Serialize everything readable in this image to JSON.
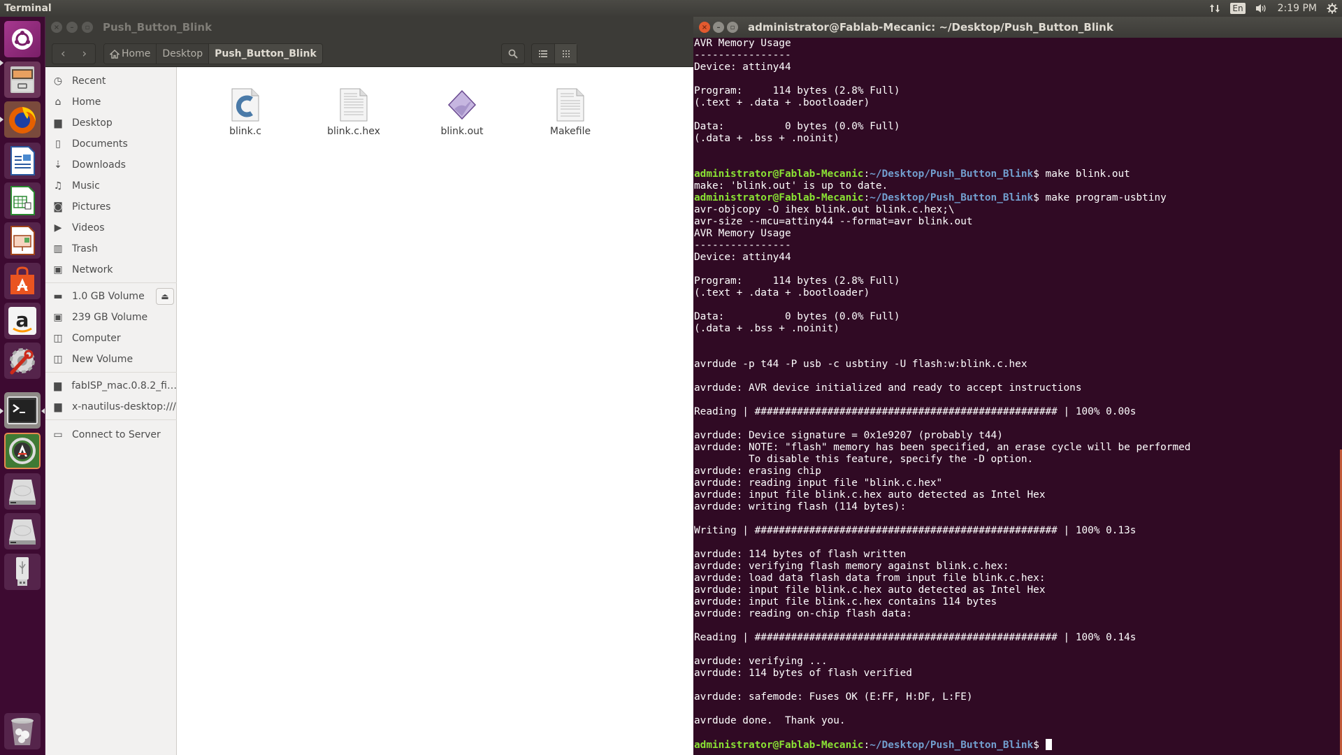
{
  "top_panel": {
    "app_title": "Terminal",
    "indicators": {
      "network": "network-icon",
      "keyboard_layout": "En",
      "sound": "sound-icon",
      "clock": "2:19 PM",
      "system": "gear-icon"
    }
  },
  "launcher": {
    "items": [
      {
        "name": "dash-home",
        "icon": "ubuntu-logo-icon"
      },
      {
        "name": "files",
        "icon": "file-cabinet-icon",
        "running": true
      },
      {
        "name": "firefox",
        "icon": "firefox-icon",
        "running": true
      },
      {
        "name": "libreoffice-writer",
        "icon": "writer-document-icon"
      },
      {
        "name": "libreoffice-calc",
        "icon": "calc-spreadsheet-icon"
      },
      {
        "name": "libreoffice-impress",
        "icon": "impress-presentation-icon"
      },
      {
        "name": "ubuntu-software",
        "icon": "software-bag-icon"
      },
      {
        "name": "amazon",
        "icon": "amazon-icon"
      },
      {
        "name": "system-settings",
        "icon": "settings-wrench-icon"
      },
      {
        "name": "terminal",
        "icon": "terminal-icon",
        "running": true,
        "focused": true
      },
      {
        "name": "software-updater",
        "icon": "updater-icon"
      },
      {
        "name": "drive-1",
        "icon": "hard-drive-icon"
      },
      {
        "name": "drive-2",
        "icon": "hard-drive-icon"
      },
      {
        "name": "usb-drive",
        "icon": "usb-drive-icon"
      },
      {
        "name": "trash",
        "icon": "trash-icon"
      }
    ]
  },
  "nautilus": {
    "title": "Push_Button_Blink",
    "breadcrumbs": [
      "Home",
      "Desktop",
      "Push_Button_Blink"
    ],
    "sidebar": {
      "places": [
        {
          "label": "Recent",
          "icon": "clock-icon"
        },
        {
          "label": "Home",
          "icon": "home-icon"
        },
        {
          "label": "Desktop",
          "icon": "folder-icon"
        },
        {
          "label": "Documents",
          "icon": "document-icon"
        },
        {
          "label": "Downloads",
          "icon": "download-icon"
        },
        {
          "label": "Music",
          "icon": "music-icon"
        },
        {
          "label": "Pictures",
          "icon": "camera-icon"
        },
        {
          "label": "Videos",
          "icon": "video-icon"
        },
        {
          "label": "Trash",
          "icon": "trash-icon"
        },
        {
          "label": "Network",
          "icon": "network-icon"
        }
      ],
      "devices": [
        {
          "label": "1.0 GB Volume",
          "icon": "drive-icon",
          "eject": true
        },
        {
          "label": "239 GB Volume",
          "icon": "chip-drive-icon"
        },
        {
          "label": "Computer",
          "icon": "hard-disk-icon"
        },
        {
          "label": "New Volume",
          "icon": "hard-disk-icon"
        }
      ],
      "bookmarks": [
        {
          "label": "fabISP_mac.0.8.2_fi…",
          "icon": "folder-icon"
        },
        {
          "label": "x-nautilus-desktop:///",
          "icon": "desktop-folder-icon"
        }
      ],
      "other": [
        {
          "label": "Connect to Server",
          "icon": "server-icon"
        }
      ]
    },
    "files": [
      {
        "name": "blink.c",
        "icon": "c-source-file-icon"
      },
      {
        "name": "blink.c.hex",
        "icon": "text-file-icon"
      },
      {
        "name": "blink.out",
        "icon": "executable-file-icon"
      },
      {
        "name": "Makefile",
        "icon": "text-file-icon"
      }
    ]
  },
  "terminal": {
    "title": "administrator@Fablab-Mecanic: ~/Desktop/Push_Button_Blink",
    "prompt": {
      "user_host": "administrator@Fablab-Mecanic",
      "colon": ":",
      "path": "~/Desktop/Push_Button_Blink",
      "symbol": "$"
    },
    "lines": [
      {
        "text": "AVR Memory Usage"
      },
      {
        "text": "----------------"
      },
      {
        "text": "Device: attiny44"
      },
      {
        "text": ""
      },
      {
        "text": "Program:     114 bytes (2.8% Full)"
      },
      {
        "text": "(.text + .data + .bootloader)"
      },
      {
        "text": ""
      },
      {
        "text": "Data:          0 bytes (0.0% Full)"
      },
      {
        "text": "(.data + .bss + .noinit)"
      },
      {
        "text": ""
      },
      {
        "text": ""
      },
      {
        "prompt": true,
        "text": " make blink.out"
      },
      {
        "text": "make: 'blink.out' is up to date."
      },
      {
        "prompt": true,
        "text": " make program-usbtiny"
      },
      {
        "text": "avr-objcopy -O ihex blink.out blink.c.hex;\\"
      },
      {
        "text": "avr-size --mcu=attiny44 --format=avr blink.out"
      },
      {
        "text": "AVR Memory Usage"
      },
      {
        "text": "----------------"
      },
      {
        "text": "Device: attiny44"
      },
      {
        "text": ""
      },
      {
        "text": "Program:     114 bytes (2.8% Full)"
      },
      {
        "text": "(.text + .data + .bootloader)"
      },
      {
        "text": ""
      },
      {
        "text": "Data:          0 bytes (0.0% Full)"
      },
      {
        "text": "(.data + .bss + .noinit)"
      },
      {
        "text": ""
      },
      {
        "text": ""
      },
      {
        "text": "avrdude -p t44 -P usb -c usbtiny -U flash:w:blink.c.hex"
      },
      {
        "text": ""
      },
      {
        "text": "avrdude: AVR device initialized and ready to accept instructions"
      },
      {
        "text": ""
      },
      {
        "text": "Reading | ################################################## | 100% 0.00s"
      },
      {
        "text": ""
      },
      {
        "text": "avrdude: Device signature = 0x1e9207 (probably t44)"
      },
      {
        "text": "avrdude: NOTE: \"flash\" memory has been specified, an erase cycle will be performed"
      },
      {
        "text": "         To disable this feature, specify the -D option."
      },
      {
        "text": "avrdude: erasing chip"
      },
      {
        "text": "avrdude: reading input file \"blink.c.hex\""
      },
      {
        "text": "avrdude: input file blink.c.hex auto detected as Intel Hex"
      },
      {
        "text": "avrdude: writing flash (114 bytes):"
      },
      {
        "text": ""
      },
      {
        "text": "Writing | ################################################## | 100% 0.13s"
      },
      {
        "text": ""
      },
      {
        "text": "avrdude: 114 bytes of flash written"
      },
      {
        "text": "avrdude: verifying flash memory against blink.c.hex:"
      },
      {
        "text": "avrdude: load data flash data from input file blink.c.hex:"
      },
      {
        "text": "avrdude: input file blink.c.hex auto detected as Intel Hex"
      },
      {
        "text": "avrdude: input file blink.c.hex contains 114 bytes"
      },
      {
        "text": "avrdude: reading on-chip flash data:"
      },
      {
        "text": ""
      },
      {
        "text": "Reading | ################################################## | 100% 0.14s"
      },
      {
        "text": ""
      },
      {
        "text": "avrdude: verifying ..."
      },
      {
        "text": "avrdude: 114 bytes of flash verified"
      },
      {
        "text": ""
      },
      {
        "text": "avrdude: safemode: Fuses OK (E:FF, H:DF, L:FE)"
      },
      {
        "text": ""
      },
      {
        "text": "avrdude done.  Thank you."
      },
      {
        "text": ""
      },
      {
        "prompt": true,
        "text": " ",
        "cursor": true
      }
    ]
  },
  "colors": {
    "terminal_bg": "#300a24",
    "prompt_user": "#8ae234",
    "prompt_path": "#729fcf",
    "launcher_bg": "#3d0a31",
    "panel_bg": "#3c3b37",
    "scrollbar": "#c25b3a"
  }
}
